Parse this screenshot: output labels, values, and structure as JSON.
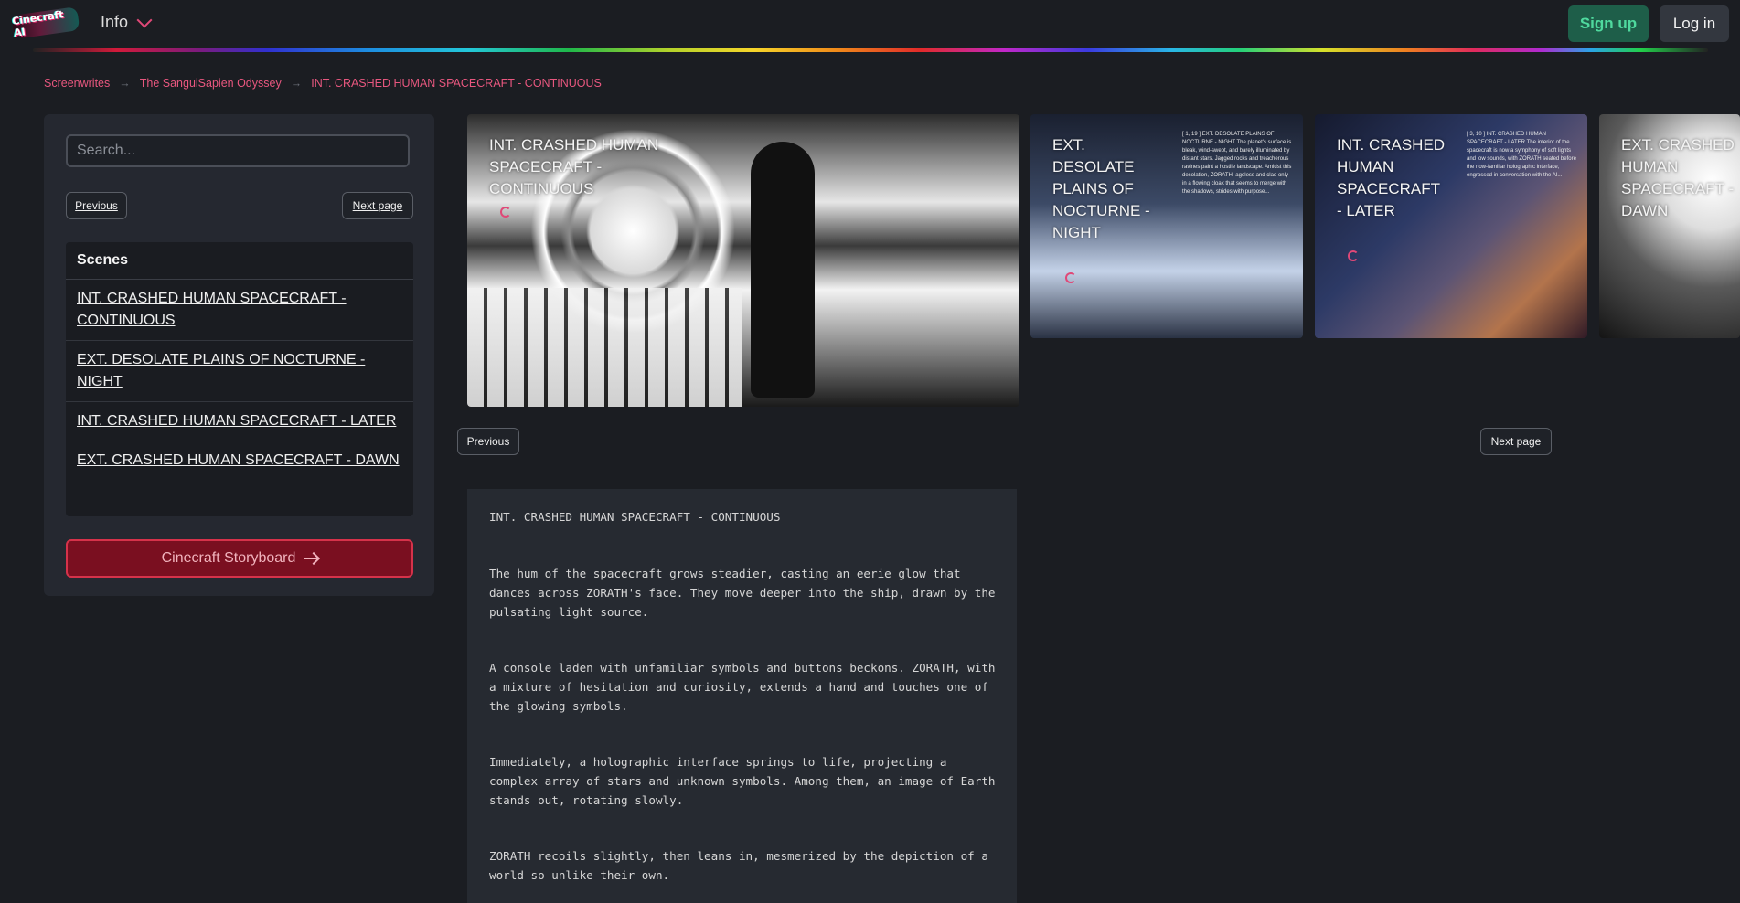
{
  "header": {
    "logo_text": "Cinecraft AI",
    "info_label": "Info",
    "signup_label": "Sign up",
    "login_label": "Log in"
  },
  "breadcrumb": {
    "items": [
      "Screenwrites",
      "The SanguiSapien Odyssey",
      "INT. CRASHED HUMAN SPACECRAFT - CONTINUOUS"
    ],
    "separator": "→"
  },
  "sidebar": {
    "search_placeholder": "Search...",
    "previous_label": "Previous",
    "next_label": "Next page",
    "scenes_title": "Scenes",
    "scenes": [
      "INT. CRASHED HUMAN SPACECRAFT - CONTINUOUS",
      "EXT. DESOLATE PLAINS OF NOCTURNE - NIGHT",
      "INT. CRASHED HUMAN SPACECRAFT - LATER",
      "EXT. CRASHED HUMAN SPACECRAFT - DAWN"
    ],
    "storyboard_label": "Cinecraft Storyboard"
  },
  "gallery": {
    "cards": [
      {
        "title": "INT. CRASHED HUMAN SPACECRAFT - CONTINUOUS",
        "desc": ""
      },
      {
        "title": "EXT. DESOLATE PLAINS OF NOCTURNE - NIGHT",
        "desc": "[ 1, 19 ] EXT. DESOLATE PLAINS OF NOCTURNE - NIGHT The planet's surface is bleak, wind-swept, and barely illuminated by distant stars. Jagged rocks and treacherous ravines paint a hostile landscape. Amidst this desolation, ZORATH, ageless and clad only in a flowing cloak that seems to merge with the shadows, strides with purpose..."
      },
      {
        "title": "INT. CRASHED HUMAN SPACECRAFT - LATER",
        "desc": "[ 3, 10 ] INT. CRASHED HUMAN SPACECRAFT - LATER The interior of the spacecraft is now a symphony of soft lights and low sounds, with ZORATH seated before the now-familiar holographic interface, engrossed in conversation with the AI..."
      },
      {
        "title": "EXT. CRASHED HUMAN SPACECRAFT - DAWN",
        "desc": ""
      }
    ],
    "previous_label": "Previous",
    "next_label": "Next page"
  },
  "script": {
    "heading": "INT. CRASHED HUMAN SPACECRAFT - CONTINUOUS",
    "paragraphs": [
      "The hum of the spacecraft grows steadier, casting an eerie glow that dances across ZORATH's face. They move deeper into the ship, drawn by the pulsating light source.",
      "A console laden with unfamiliar symbols and buttons beckons. ZORATH, with a mixture of hesitation and curiosity, extends a hand and touches one of the glowing symbols.",
      "Immediately, a holographic interface springs to life, projecting a complex array of stars and unknown symbols. Among them, an image of Earth stands out, rotating slowly.",
      "ZORATH recoils slightly, then leans in, mesmerized by the depiction of a world so unlike their own."
    ]
  }
}
